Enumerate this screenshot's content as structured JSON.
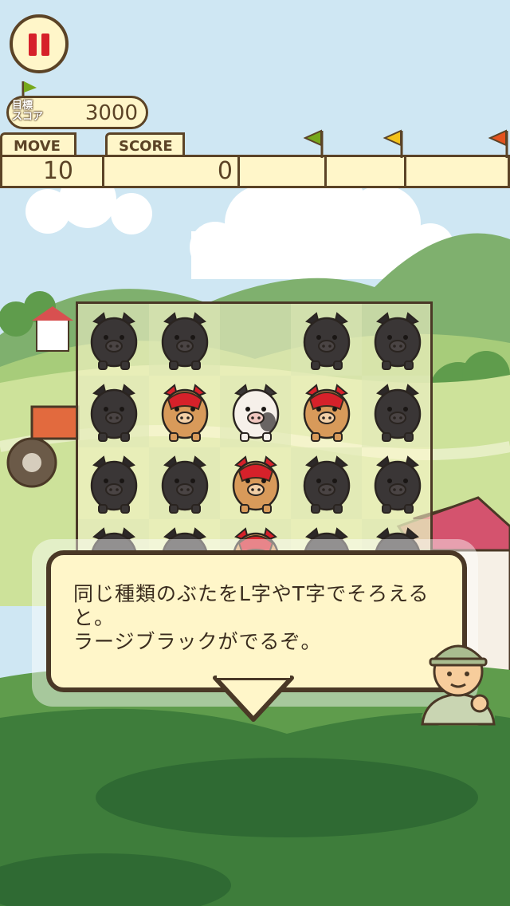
{
  "hud": {
    "target_label_1": "目標",
    "target_label_2": "スコア",
    "target_score": "3000",
    "move_label": "MOVE",
    "move_value": "10",
    "score_label": "SCORE",
    "score_value": "0",
    "score_progress": 0,
    "flag_colors": [
      "#77a81c",
      "#f2c21a",
      "#e4531e"
    ]
  },
  "board": {
    "columns": 5,
    "visible_rows": 4,
    "tiles": [
      [
        "black-pig",
        "black-pig",
        "",
        "black-pig",
        "black-pig"
      ],
      [
        "black-pig",
        "red-pig",
        "white-pig",
        "red-pig",
        "black-pig"
      ],
      [
        "black-pig",
        "black-pig",
        "red-pig",
        "black-pig",
        "black-pig"
      ],
      [
        "black-pig",
        "black-pig",
        "red-pig",
        "black-pig",
        "black-pig"
      ]
    ]
  },
  "dialog": {
    "text": "同じ種類のぶたをL字やT字でそろえると。\nラージブラックがでるぞ。"
  },
  "colors": {
    "ink": "#4a3826",
    "panel": "#fff6c9",
    "pause_red": "#d6212a"
  }
}
